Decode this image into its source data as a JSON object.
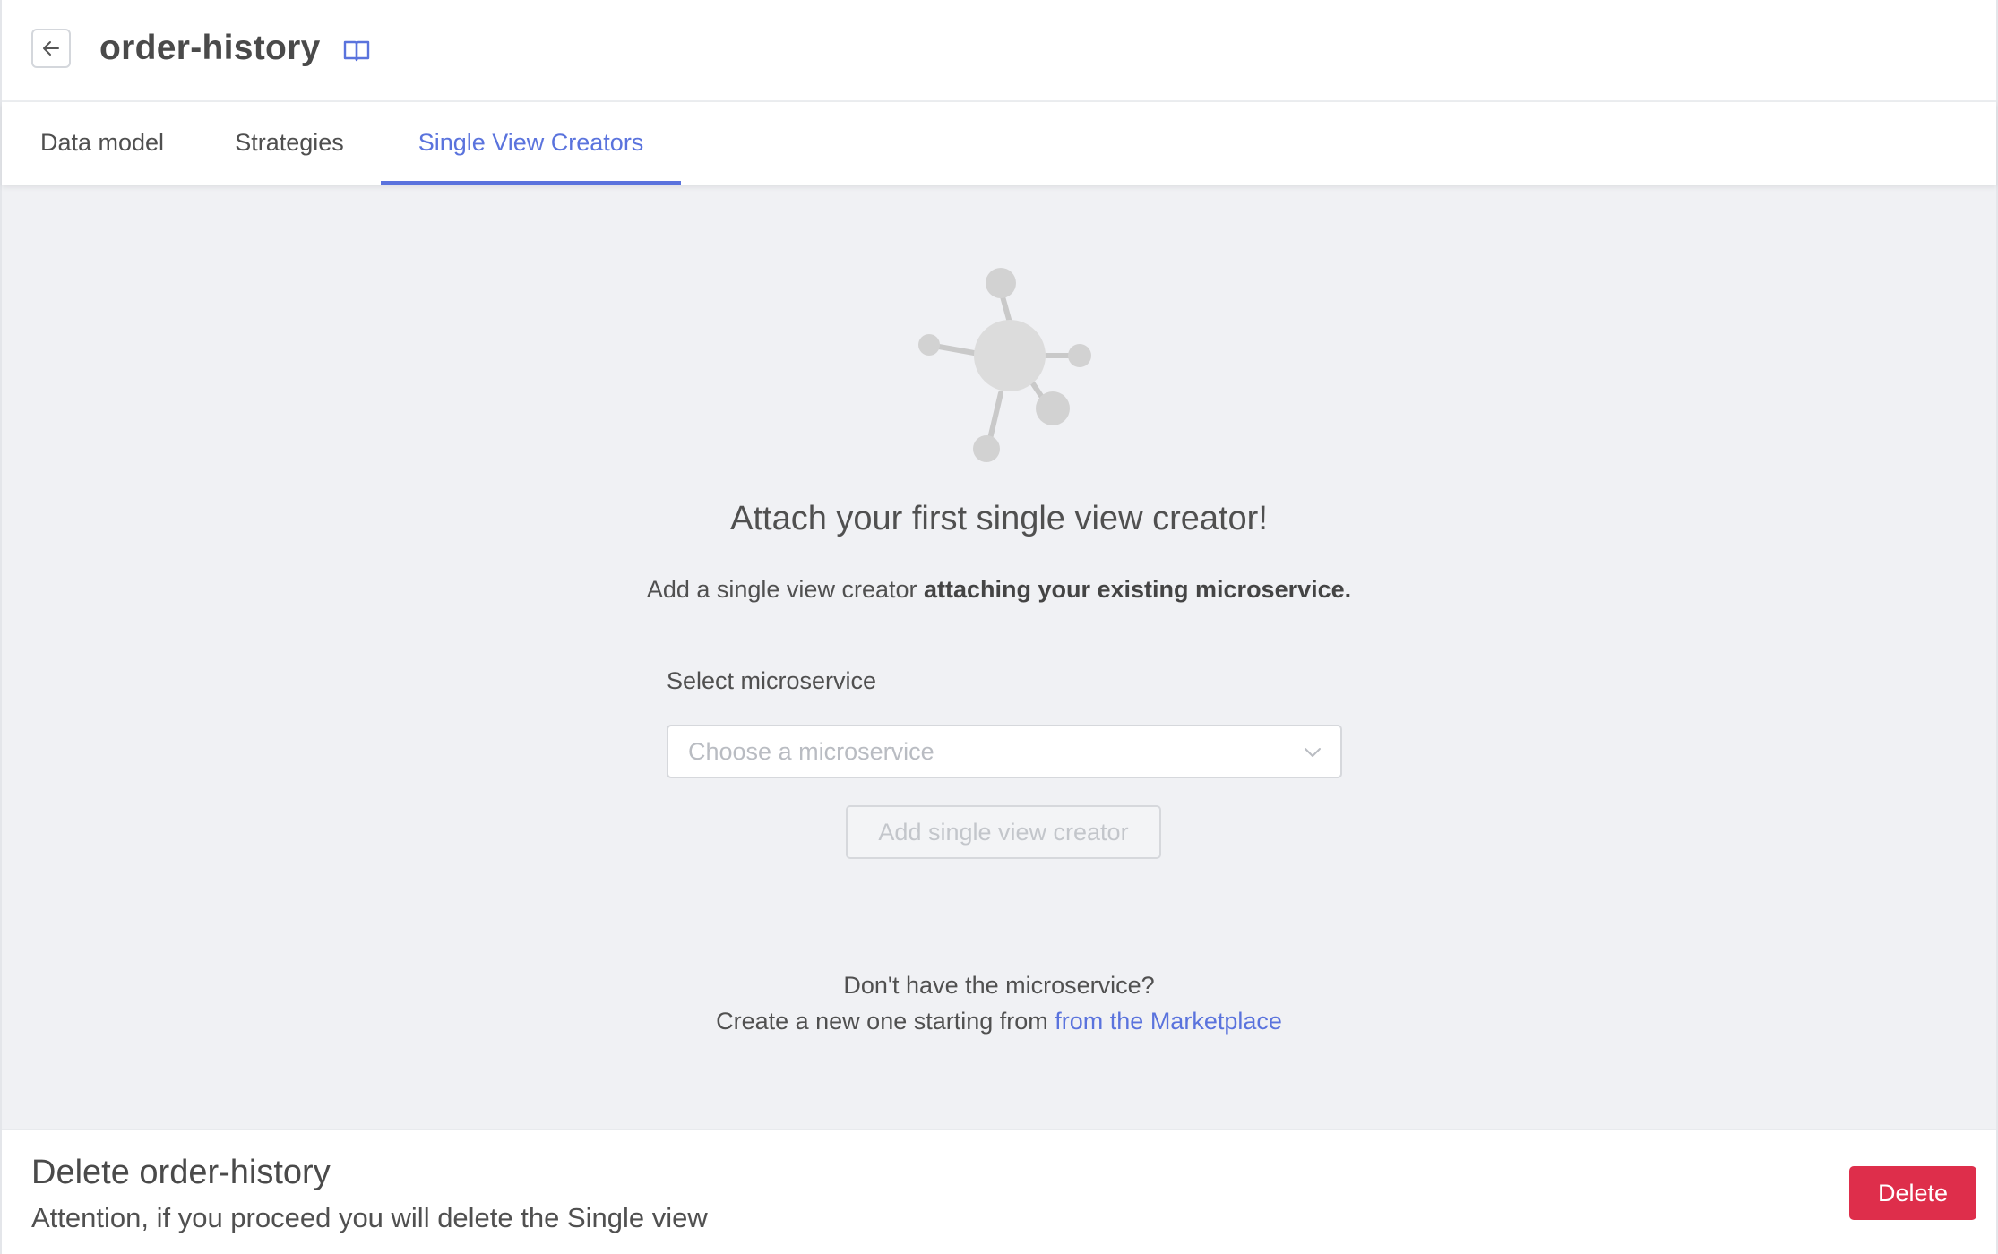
{
  "header": {
    "back_icon": "arrow-left-icon",
    "title": "order-history",
    "docs_icon": "open-book-icon"
  },
  "tabs": [
    {
      "label": "Data model",
      "active": false
    },
    {
      "label": "Strategies",
      "active": false
    },
    {
      "label": "Single View Creators",
      "active": true
    }
  ],
  "empty_state": {
    "illustration_icon": "network-hub-icon",
    "heading": "Attach your first single view creator!",
    "subtitle_prefix": "Add a single view creator ",
    "subtitle_bold": "attaching your existing microservice.",
    "select_label": "Select microservice",
    "select_placeholder": "Choose a microservice",
    "add_button_label": "Add single view creator",
    "help_line1": "Don't have the microservice?",
    "help_line2_prefix": "Create a new one starting from ",
    "help_link": "from the Marketplace"
  },
  "danger_zone": {
    "title": "Delete order-history",
    "description": "Attention, if you proceed you will delete the Single view",
    "delete_button_label": "Delete"
  },
  "colors": {
    "accent": "#5a73dd",
    "danger": "#de2e4b",
    "background": "#f0f1f4"
  }
}
